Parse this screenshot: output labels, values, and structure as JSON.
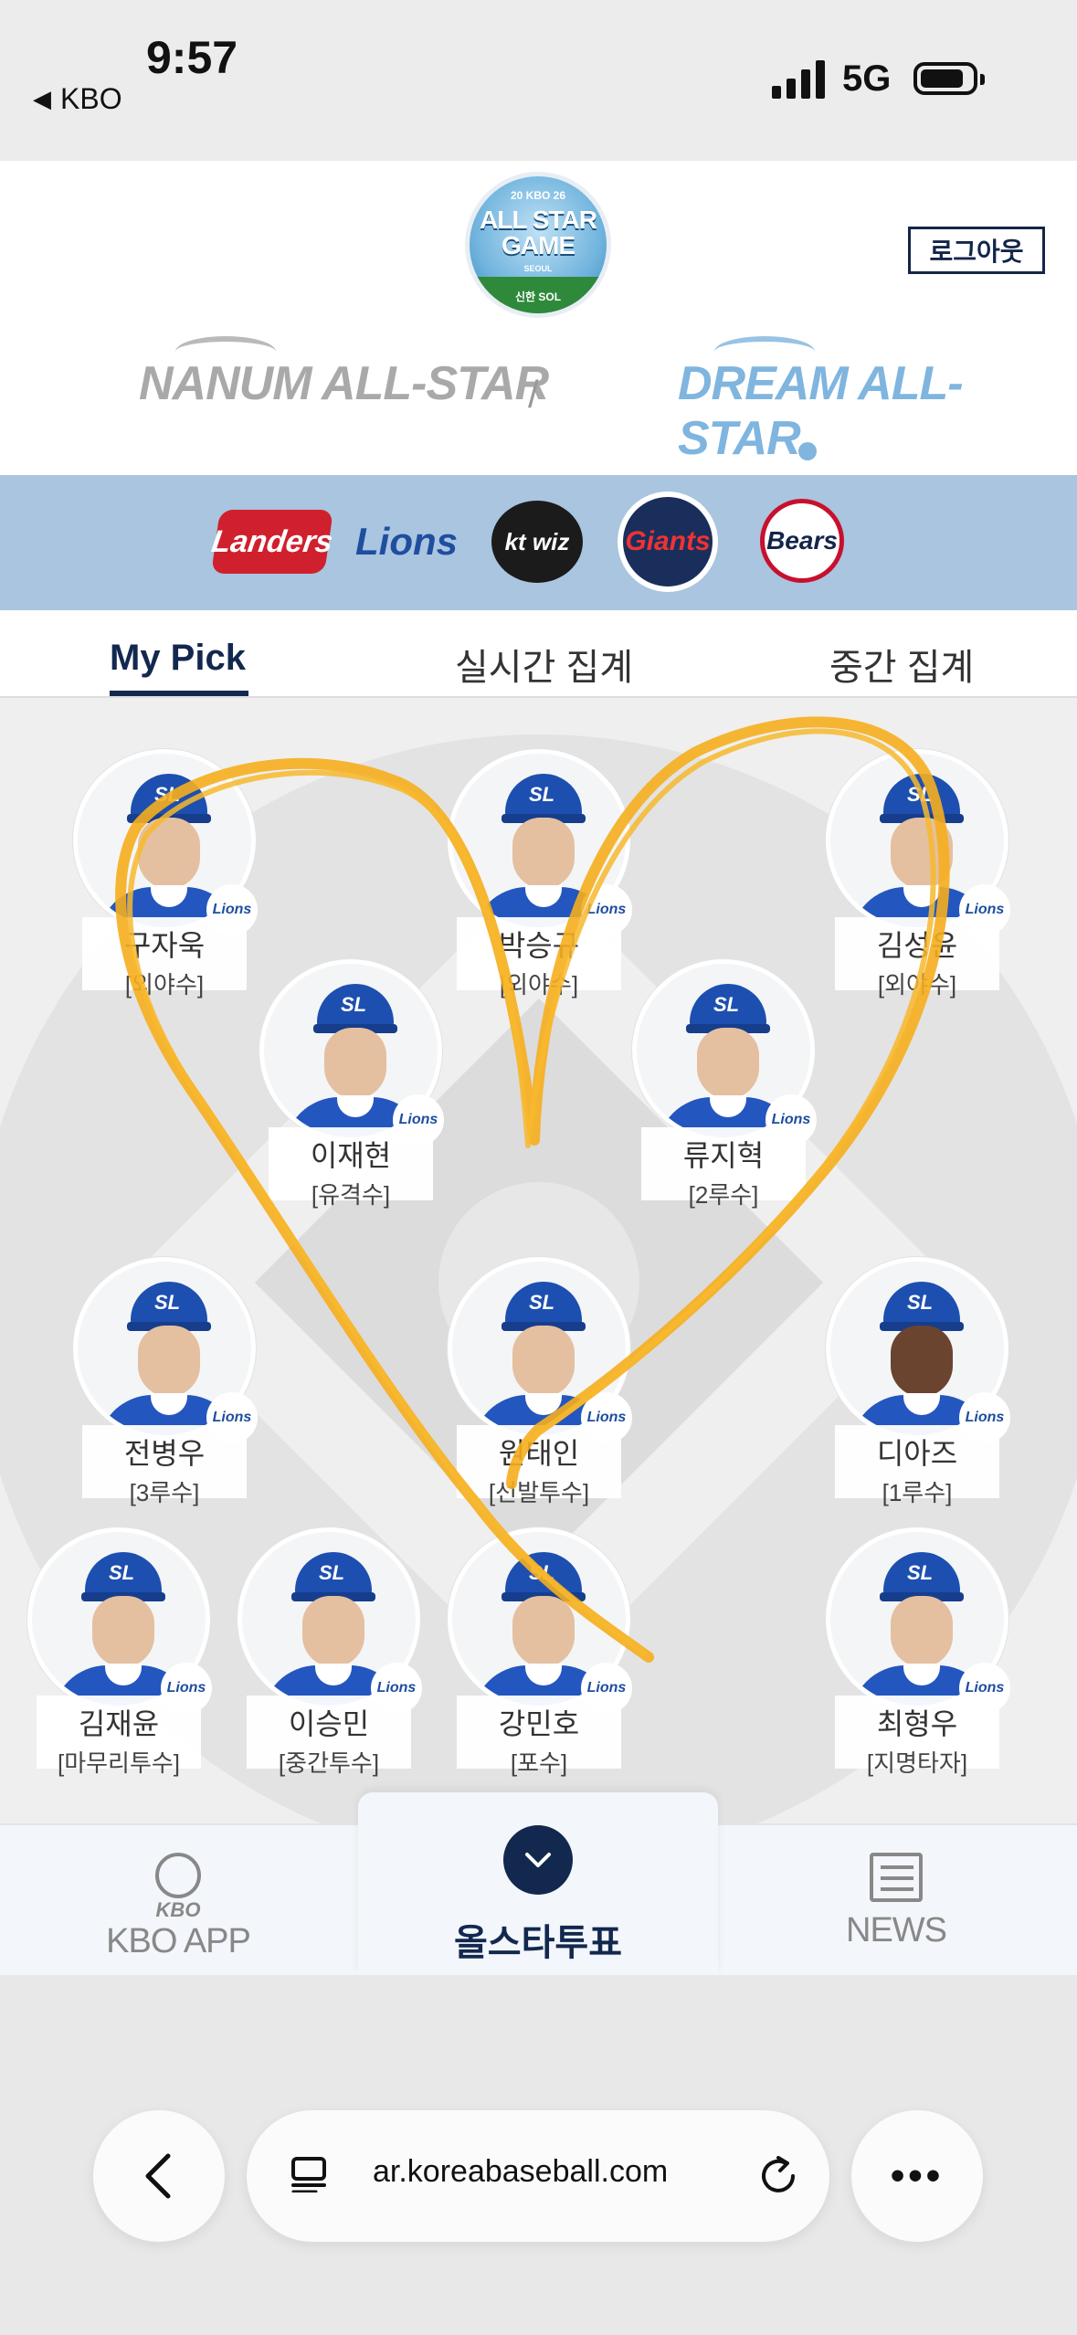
{
  "status_bar": {
    "time": "9:57",
    "back_app": "KBO",
    "network": "5G"
  },
  "header": {
    "emblem": {
      "top": "20 KBO 26",
      "title": "ALL STAR GAME",
      "city": "SEOUL",
      "sponsor": "신한 SOL"
    },
    "logout_label": "로그아웃",
    "league_left": "NANUM ALL-STAR",
    "league_divider": "/",
    "league_right": "DREAM ALL-STAR",
    "selected_league": "DREAM ALL-STAR"
  },
  "teams": [
    "Landers",
    "Lions",
    "kt wiz",
    "Giants",
    "Bears"
  ],
  "tabs": [
    "My Pick",
    "실시간 집계",
    "중간 집계"
  ],
  "active_tab": "My Pick",
  "players": [
    {
      "name": "구자욱",
      "position": "[외야수]"
    },
    {
      "name": "박승규",
      "position": "[외야수]"
    },
    {
      "name": "김성윤",
      "position": "[외야수]"
    },
    {
      "name": "이재현",
      "position": "[유격수]"
    },
    {
      "name": "류지혁",
      "position": "[2루수]"
    },
    {
      "name": "전병우",
      "position": "[3루수]"
    },
    {
      "name": "원태인",
      "position": "[선발투수]"
    },
    {
      "name": "디아즈",
      "position": "[1루수]"
    },
    {
      "name": "김재윤",
      "position": "[마무리투수]"
    },
    {
      "name": "이승민",
      "position": "[중간투수]"
    },
    {
      "name": "강민호",
      "position": "[포수]"
    },
    {
      "name": "최형우",
      "position": "[지명타자]"
    }
  ],
  "team_badge": "Lions",
  "bottom_nav": {
    "kbo_sub": "KBO",
    "kbo_app": "KBO APP",
    "vote": "올스타투표",
    "news": "NEWS"
  },
  "browser": {
    "url": "ar.koreabaseball.com"
  },
  "colors": {
    "navy": "#13284f",
    "team_bar": "#a9c5df",
    "lions_blue": "#1f4ea0",
    "heart_stroke": "#f5ae1e"
  }
}
